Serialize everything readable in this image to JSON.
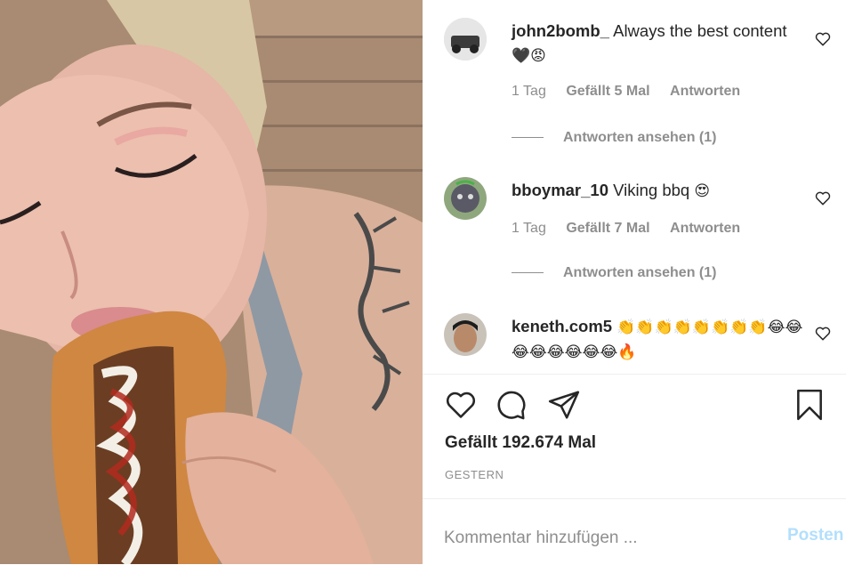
{
  "comments": [
    {
      "username": "john2bomb_",
      "text": "Always the best content",
      "emoji": "🖤😡",
      "time": "1 Tag",
      "likes": "Gefällt 5 Mal",
      "reply": "Antworten",
      "view_replies": "Antworten ansehen (1)"
    },
    {
      "username": "bboymar_10",
      "text": "Viking bbq",
      "emoji": "😍",
      "time": "1 Tag",
      "likes": "Gefällt 7 Mal",
      "reply": "Antworten",
      "view_replies": "Antworten ansehen (1)"
    },
    {
      "username": "keneth.com5",
      "text": "",
      "emoji": "👏👏👏👏👏👏👏👏😂😂😂😂😂😂😂😂🔥"
    }
  ],
  "post": {
    "likes": "Gefällt 192.674 Mal",
    "date": "GESTERN"
  },
  "add_comment": {
    "placeholder": "Kommentar hinzufügen ...",
    "post_label": "Posten"
  },
  "icons": {
    "like": "heart-outline-icon",
    "comment": "speech-bubble-icon",
    "share": "paper-plane-icon",
    "save": "bookmark-icon"
  }
}
